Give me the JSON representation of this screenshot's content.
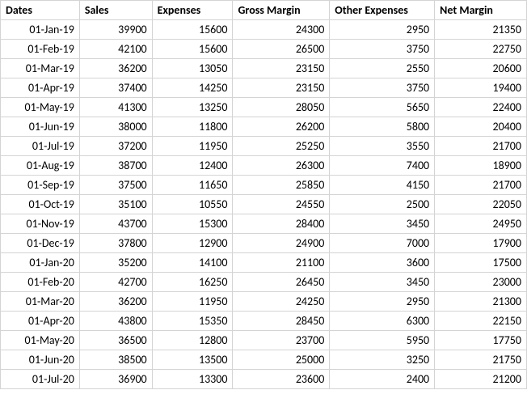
{
  "headers": {
    "dates": "Dates",
    "sales": "Sales",
    "expenses": "Expenses",
    "gross_margin": "Gross Margin",
    "other_expenses": "Other Expenses",
    "net_margin": "Net Margin"
  },
  "rows": [
    {
      "date": "01-Jan-19",
      "sales": "39900",
      "expenses": "15600",
      "gross": "24300",
      "other": "2950",
      "net": "21350"
    },
    {
      "date": "01-Feb-19",
      "sales": "42100",
      "expenses": "15600",
      "gross": "26500",
      "other": "3750",
      "net": "22750"
    },
    {
      "date": "01-Mar-19",
      "sales": "36200",
      "expenses": "13050",
      "gross": "23150",
      "other": "2550",
      "net": "20600"
    },
    {
      "date": "01-Apr-19",
      "sales": "37400",
      "expenses": "14250",
      "gross": "23150",
      "other": "3750",
      "net": "19400"
    },
    {
      "date": "01-May-19",
      "sales": "41300",
      "expenses": "13250",
      "gross": "28050",
      "other": "5650",
      "net": "22400"
    },
    {
      "date": "01-Jun-19",
      "sales": "38000",
      "expenses": "11800",
      "gross": "26200",
      "other": "5800",
      "net": "20400"
    },
    {
      "date": "01-Jul-19",
      "sales": "37200",
      "expenses": "11950",
      "gross": "25250",
      "other": "3550",
      "net": "21700"
    },
    {
      "date": "01-Aug-19",
      "sales": "38700",
      "expenses": "12400",
      "gross": "26300",
      "other": "7400",
      "net": "18900"
    },
    {
      "date": "01-Sep-19",
      "sales": "37500",
      "expenses": "11650",
      "gross": "25850",
      "other": "4150",
      "net": "21700"
    },
    {
      "date": "01-Oct-19",
      "sales": "35100",
      "expenses": "10550",
      "gross": "24550",
      "other": "2500",
      "net": "22050"
    },
    {
      "date": "01-Nov-19",
      "sales": "43700",
      "expenses": "15300",
      "gross": "28400",
      "other": "3450",
      "net": "24950"
    },
    {
      "date": "01-Dec-19",
      "sales": "37800",
      "expenses": "12900",
      "gross": "24900",
      "other": "7000",
      "net": "17900"
    },
    {
      "date": "01-Jan-20",
      "sales": "35200",
      "expenses": "14100",
      "gross": "21100",
      "other": "3600",
      "net": "17500"
    },
    {
      "date": "01-Feb-20",
      "sales": "42700",
      "expenses": "16250",
      "gross": "26450",
      "other": "3450",
      "net": "23000"
    },
    {
      "date": "01-Mar-20",
      "sales": "36200",
      "expenses": "11950",
      "gross": "24250",
      "other": "2950",
      "net": "21300"
    },
    {
      "date": "01-Apr-20",
      "sales": "43800",
      "expenses": "15350",
      "gross": "28450",
      "other": "6300",
      "net": "22150"
    },
    {
      "date": "01-May-20",
      "sales": "36500",
      "expenses": "12800",
      "gross": "23700",
      "other": "5950",
      "net": "17750"
    },
    {
      "date": "01-Jun-20",
      "sales": "38500",
      "expenses": "13500",
      "gross": "25000",
      "other": "3250",
      "net": "21750"
    },
    {
      "date": "01-Jul-20",
      "sales": "36900",
      "expenses": "13300",
      "gross": "23600",
      "other": "2400",
      "net": "21200"
    }
  ]
}
